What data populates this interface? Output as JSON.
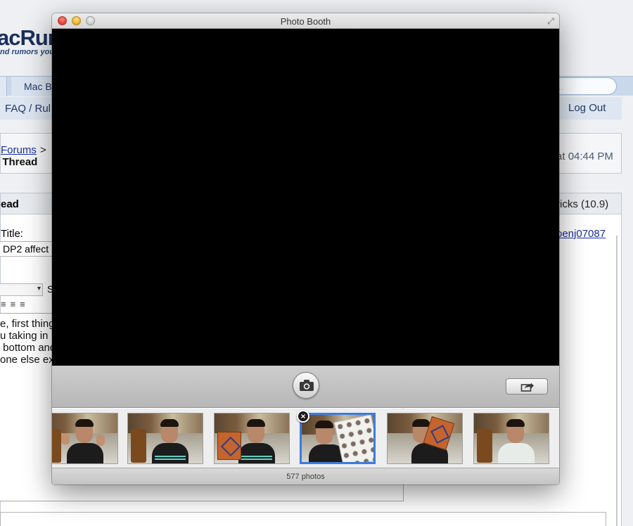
{
  "background_page": {
    "logo": "acRum",
    "tagline": "nd rumors you",
    "nav_tab": "Mac B",
    "search_placeholder": "s...",
    "faq": "FAQ / Rul",
    "logout": "Log Out",
    "breadcrumb_forums": "Forums",
    "breadcrumb_sep": ">",
    "thread_heading": "/ Thread",
    "time_prefix": "at",
    "time": "04:44 PM",
    "section_heading": "ead",
    "tricks_label": "ricks (10.9)",
    "title_label": "Title:",
    "user_link": "oenj07087",
    "title_value": "DP2 affect",
    "select_s": "S",
    "editor_text": "e, first thing\nu taking in\n bottom and\none else ex"
  },
  "window": {
    "title": "Photo Booth",
    "controls": {
      "close": "close",
      "minimize": "minimize",
      "zoom": "zoom",
      "fullscreen": "⤢"
    },
    "toolbar": {
      "shutter_icon": "camera-icon",
      "share_icon": "share-icon"
    },
    "thumbnails": [
      {
        "name": "photo-1",
        "selected": false
      },
      {
        "name": "photo-2",
        "selected": false
      },
      {
        "name": "photo-3",
        "selected": false
      },
      {
        "name": "photo-4",
        "selected": true
      },
      {
        "name": "photo-5",
        "selected": false
      },
      {
        "name": "photo-6",
        "selected": false
      }
    ],
    "delete_badge": "×",
    "photo_count": "577 photos"
  },
  "colors": {
    "selection": "#3b7ce0",
    "viewer": "#000000"
  }
}
